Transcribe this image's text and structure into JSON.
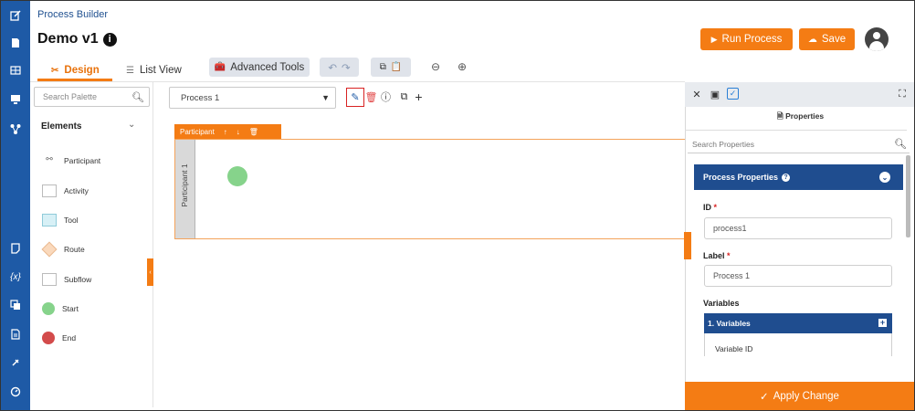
{
  "app": {
    "title": "Process Builder",
    "doc_title": "Demo v1",
    "info_glyph": "i"
  },
  "header": {
    "run_label": "Run Process",
    "save_label": "Save"
  },
  "tabs": [
    {
      "label": "Design",
      "active": true
    },
    {
      "label": "List View",
      "active": false
    }
  ],
  "toolbar": {
    "advanced_tools": "Advanced Tools"
  },
  "palette": {
    "search_placeholder": "Search Palette",
    "section_title": "Elements",
    "items": [
      {
        "label": "Participant",
        "icon": "participant-icon"
      },
      {
        "label": "Activity",
        "icon": "activity-shape"
      },
      {
        "label": "Tool",
        "icon": "tool-shape"
      },
      {
        "label": "Route",
        "icon": "route-diamond"
      },
      {
        "label": "Subflow",
        "icon": "subflow-shape"
      },
      {
        "label": "Start",
        "icon": "start-circle"
      },
      {
        "label": "End",
        "icon": "end-circle"
      }
    ]
  },
  "canvas": {
    "process_selected": "Process 1",
    "pool_header": "Participant",
    "lane_label": "Participant 1"
  },
  "properties": {
    "title": "Properties",
    "search_placeholder": "Search Properties",
    "section": "Process Properties",
    "id_label": "ID",
    "id_value": "process1",
    "label_label": "Label",
    "label_value": "Process 1",
    "variables_label": "Variables",
    "variables_group": "1. Variables",
    "variable_field": "Variable ID",
    "apply_label": "Apply Change"
  },
  "colors": {
    "accent": "#f47c14",
    "rail": "#1e5aa6",
    "panel_header": "#1f4d8f",
    "start": "#86d38b",
    "end": "#d34b4b"
  }
}
